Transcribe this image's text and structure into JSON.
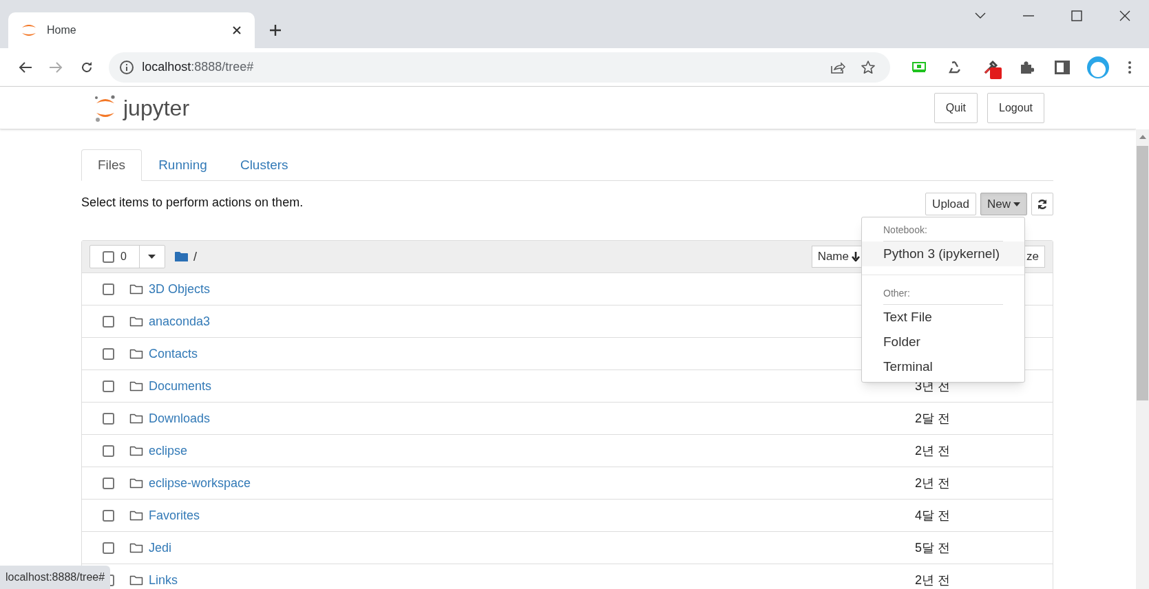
{
  "browser": {
    "tab": {
      "title": "Home"
    },
    "address": {
      "host": "localhost",
      "rest": ":8888/tree#"
    },
    "status_url": "localhost:8888/tree#"
  },
  "header": {
    "logo_text": "jupyter",
    "buttons": [
      "Quit",
      "Logout"
    ]
  },
  "tabs": [
    {
      "label": "Files",
      "selected": true
    },
    {
      "label": "Running",
      "selected": false
    },
    {
      "label": "Clusters",
      "selected": false
    }
  ],
  "hint": "Select items to perform actions on them.",
  "actions": {
    "upload": "Upload",
    "new": {
      "label": "New",
      "open": true
    }
  },
  "list_header": {
    "count": "0",
    "path": "/",
    "checked": false,
    "sort_button": "Name",
    "column_3": "ze"
  },
  "new_menu": [
    {
      "kind": "header",
      "label": "Notebook:"
    },
    {
      "kind": "item",
      "label": "Python 3 (ipykernel)",
      "hovered": true
    },
    {
      "kind": "divider"
    },
    {
      "kind": "header",
      "label": "Other:"
    },
    {
      "kind": "item",
      "label": "Text File",
      "hovered": false
    },
    {
      "kind": "item",
      "label": "Folder",
      "hovered": false
    },
    {
      "kind": "item",
      "label": "Terminal",
      "hovered": false
    }
  ],
  "rows": [
    {
      "name": "3D Objects",
      "checked": false
    },
    {
      "name": "anaconda3",
      "checked": false
    },
    {
      "name": "Contacts",
      "checked": false
    },
    {
      "name": "Documents",
      "modified": "3년 전",
      "checked": false
    },
    {
      "name": "Downloads",
      "modified": "2달 전",
      "checked": false
    },
    {
      "name": "eclipse",
      "modified": "2년 전",
      "checked": false
    },
    {
      "name": "eclipse-workspace",
      "modified": "2년 전",
      "checked": false
    },
    {
      "name": "Favorites",
      "modified": "4달 전",
      "checked": false
    },
    {
      "name": "Jedi",
      "modified": "5달 전",
      "checked": false
    },
    {
      "name": "Links",
      "modified": "2년 전",
      "checked": false
    }
  ]
}
